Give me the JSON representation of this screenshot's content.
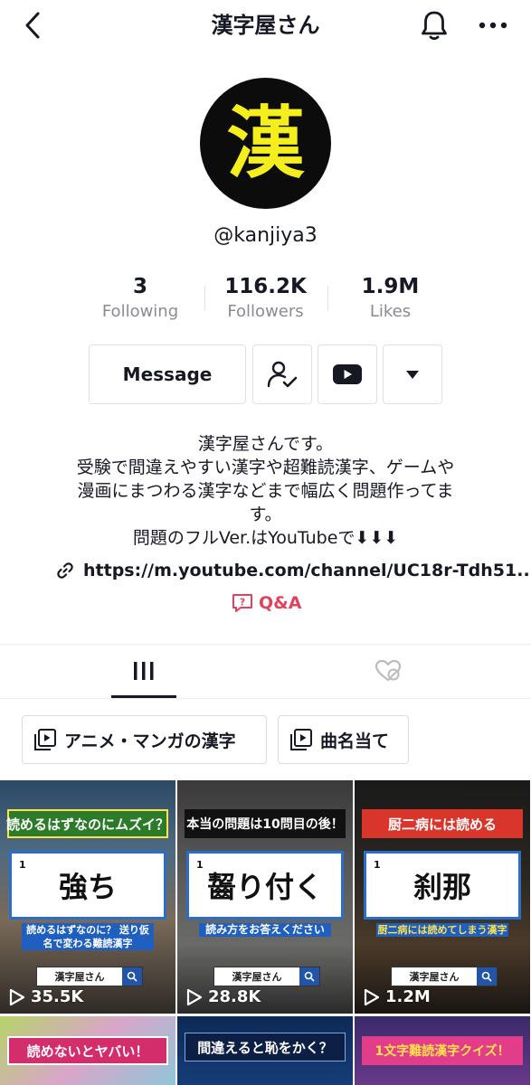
{
  "header": {
    "title": "漢字屋さん"
  },
  "profile": {
    "avatar_glyph": "漢",
    "handle": "@kanjiya3",
    "stats": [
      {
        "value": "3",
        "label": "Following"
      },
      {
        "value": "116.2K",
        "label": "Followers"
      },
      {
        "value": "1.9M",
        "label": "Likes"
      }
    ],
    "message_label": "Message",
    "bio_lines": [
      "漢字屋さんです。",
      "受験で間違えやすい漢字や超難読漢字、ゲームや",
      "漫画にまつわる漢字などまで幅広く問題作ってま",
      "す。",
      "問題のフルVer.はYouTubeで⬇⬇⬇"
    ],
    "link": "https://m.youtube.com/channel/UC18r-Tdh51...",
    "qa_label": "Q&A"
  },
  "playlists": [
    "アニメ・マンガの漢字",
    "曲名当て"
  ],
  "videos": [
    {
      "banner": "読めるはずなのにムズイ？",
      "word": "強ち",
      "num": "1",
      "sub": "読めるはずなのに？ 送り仮名で変わる難読漢字",
      "search": "漢字屋さん",
      "views": "35.5K"
    },
    {
      "banner": "本当の問題は10問目の後！",
      "word": "齧り付く",
      "num": "1",
      "sub": "読み方をお答えください",
      "search": "漢字屋さん",
      "views": "28.8K"
    },
    {
      "banner": "厨二病には読める",
      "word": "刹那",
      "num": "1",
      "sub": "厨二病には読めてしまう漢字",
      "search": "漢字屋さん",
      "views": "1.2M"
    },
    {
      "banner": "読めないとヤバい！"
    },
    {
      "banner": "間違えると恥をかく？"
    },
    {
      "banner": "1文字難読漢字クイズ！"
    }
  ],
  "colors": {
    "accent": "#e3425f",
    "avatar_glyph": "#f4ef1c",
    "text": "#161823",
    "muted": "#8a8b91"
  }
}
